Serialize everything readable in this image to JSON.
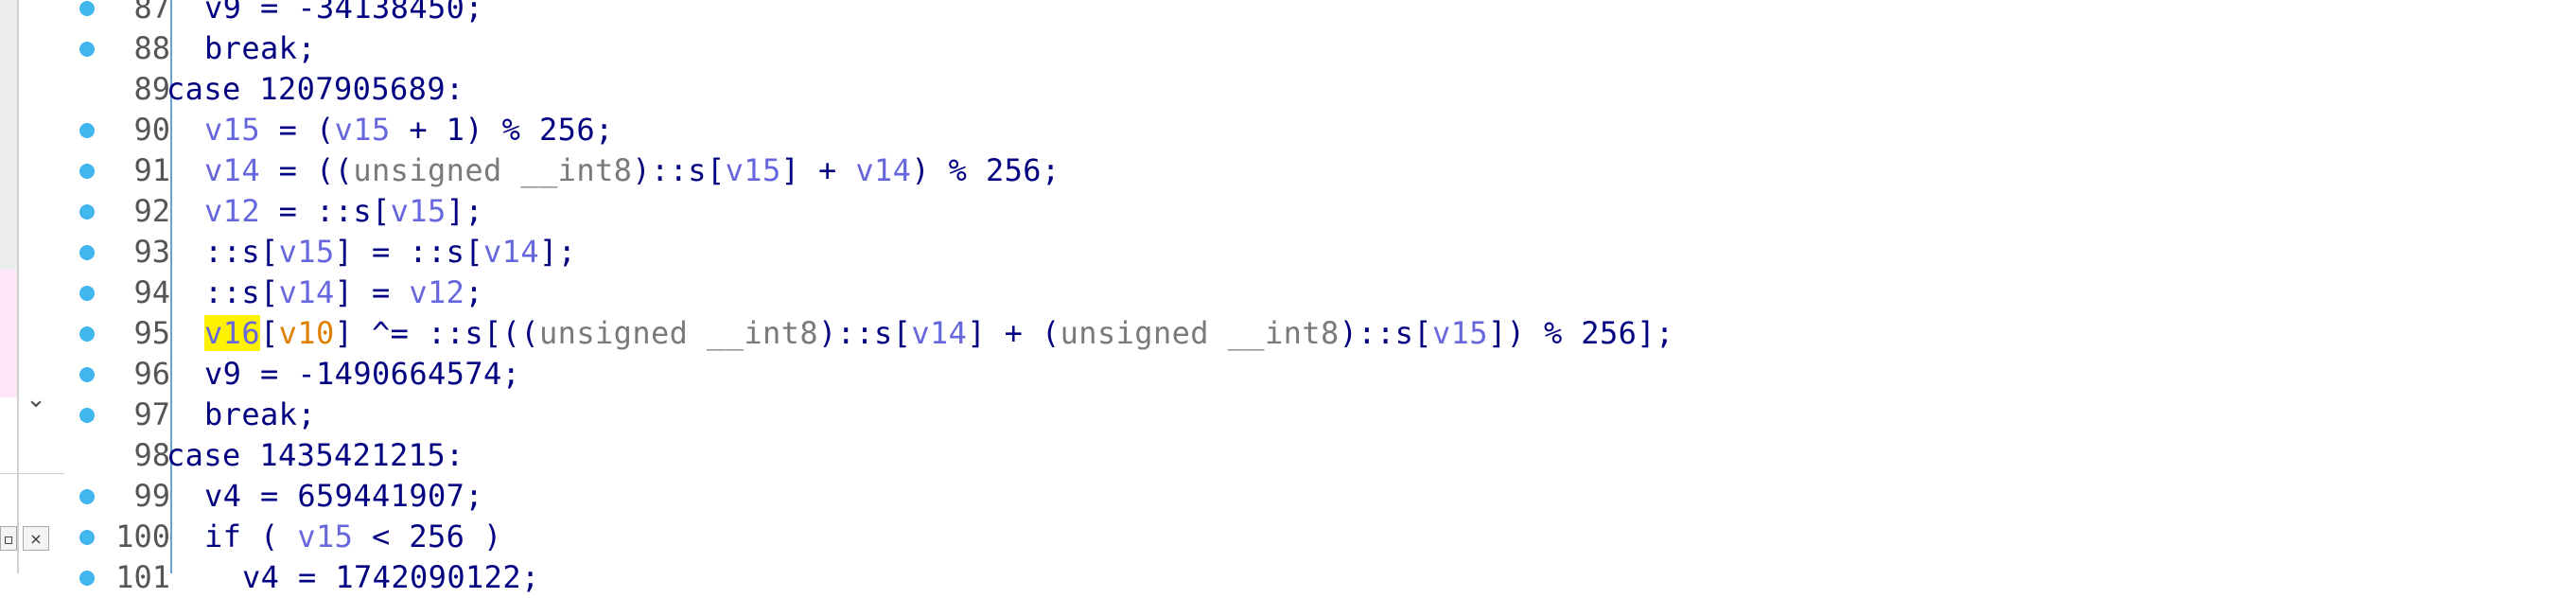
{
  "code": {
    "lines": [
      {
        "num": "87",
        "bp": true,
        "text": "v9 = -34138450;",
        "indent": 2
      },
      {
        "num": "88",
        "bp": true,
        "text": "break;",
        "indent": 2
      },
      {
        "num": "89",
        "bp": false,
        "text": "case 1207905689:",
        "indent": 1
      },
      {
        "num": "90",
        "bp": true,
        "text": "",
        "indent": 2
      },
      {
        "num": "91",
        "bp": true,
        "text": "",
        "indent": 2
      },
      {
        "num": "92",
        "bp": true,
        "text": "",
        "indent": 2
      },
      {
        "num": "93",
        "bp": true,
        "text": "",
        "indent": 2
      },
      {
        "num": "94",
        "bp": true,
        "text": "",
        "indent": 2
      },
      {
        "num": "95",
        "bp": true,
        "text": "",
        "indent": 2
      },
      {
        "num": "96",
        "bp": true,
        "text": "v9 = -1490664574;",
        "indent": 2
      },
      {
        "num": "97",
        "bp": true,
        "text": "break;",
        "indent": 2
      },
      {
        "num": "98",
        "bp": false,
        "text": "case 1435421215:",
        "indent": 1
      },
      {
        "num": "99",
        "bp": true,
        "text": "v4 = 659441907;",
        "indent": 2
      },
      {
        "num": "100",
        "bp": true,
        "text": "",
        "indent": 2
      },
      {
        "num": "101",
        "bp": true,
        "text": "v4 = 1742090122;",
        "indent": 3
      }
    ],
    "l90": {
      "a": "v15",
      "b": " = (",
      "c": "v15",
      "d": " + 1) % 256;"
    },
    "l91": {
      "a": "v14",
      "b": " = ((",
      "c": "unsigned __int8",
      "d": ")::s[",
      "e": "v15",
      "f": "] + ",
      "g": "v14",
      "h": ") % 256;"
    },
    "l92": {
      "a": "v12",
      "b": " = ::s[",
      "c": "v15",
      "d": "];"
    },
    "l93": {
      "a": "::s[",
      "b": "v15",
      "c": "] = ::s[",
      "d": "v14",
      "e": "];"
    },
    "l94": {
      "a": "::s[",
      "b": "v14",
      "c": "] = ",
      "d": "v12",
      "e": ";"
    },
    "l95": {
      "a": "v16",
      "b": "[",
      "c": "v10",
      "d": "] ^= ::s[((",
      "e": "unsigned __int8",
      "f": ")::s[",
      "g": "v14",
      "h": "] + (",
      "i": "unsigned __int8",
      "j": ")::s[",
      "k": "v15",
      "l": "]) % 256];"
    },
    "l100": {
      "a": "if ( ",
      "b": "v15",
      "c": " < 256 )"
    }
  },
  "left_panel": {
    "chevron": "⌄",
    "restore_btn": "▫",
    "close_btn": "×"
  },
  "colors": {
    "keyword": "#000080",
    "variable": "#6666dd",
    "highlight": "#fff200",
    "orange_var": "#e08000",
    "breakpoint": "#40b6ee"
  }
}
